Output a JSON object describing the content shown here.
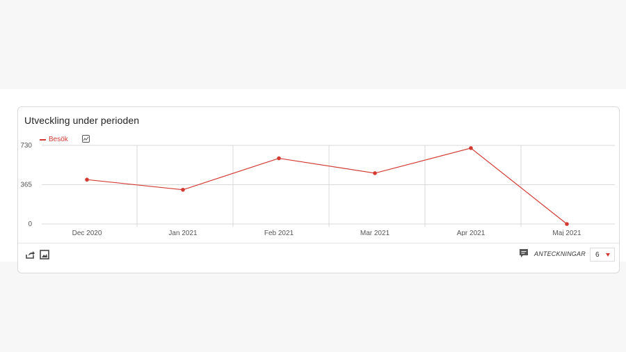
{
  "card": {
    "title": "Utveckling under perioden",
    "notes_label": "ANTECKNINGAR",
    "page_select_value": "6"
  },
  "icons": {
    "chart_toggle": "line-chart-icon",
    "share": "share-icon",
    "image": "image-export-icon",
    "notes": "comment-icon",
    "caret": "caret-down-icon"
  },
  "colors": {
    "series": "#d23a32",
    "grid": "#d9d9d9",
    "axis_text": "#555555"
  },
  "chart_data": {
    "type": "line",
    "title": "Utveckling under perioden",
    "categories": [
      "Dec 2020",
      "Jan 2021",
      "Feb 2021",
      "Mar 2021",
      "Apr 2021",
      "Maj 2021"
    ],
    "series": [
      {
        "name": "Besök",
        "values": [
          412,
          318,
          610,
          472,
          705,
          0
        ]
      }
    ],
    "yticks": [
      0,
      365,
      730
    ],
    "ylim": [
      0,
      730
    ],
    "grid": true,
    "legend": "top-left"
  }
}
